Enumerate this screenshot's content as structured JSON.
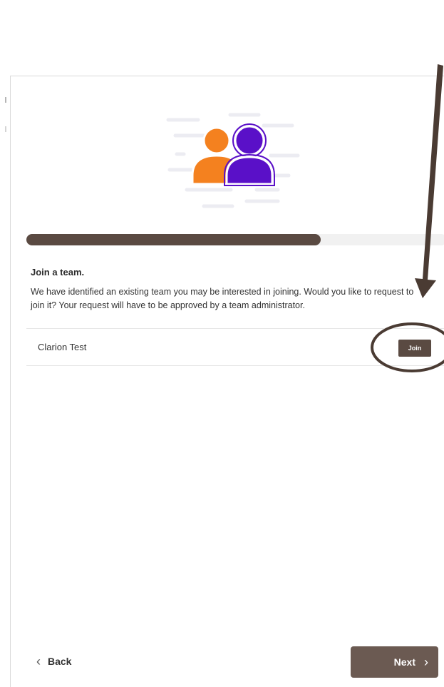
{
  "wizard": {
    "progress_fraction": 0.7
  },
  "join_team": {
    "heading": "Join a team.",
    "description": "We have identified an existing team you may be interested in joining. Would you like to request to join it? Your request will have to be approved by a team administrator.",
    "teams": [
      {
        "name": "Clarion Test",
        "action_label": "Join"
      }
    ]
  },
  "footer": {
    "back_label": "Back",
    "next_label": "Next"
  },
  "icons": {
    "back": "chevron-left-icon",
    "next": "chevron-right-icon",
    "illustration": "people-icon"
  },
  "colors": {
    "accent_brown": "#5a4a42",
    "person_orange": "#f4811f",
    "person_purple": "#5a10c8",
    "annotation_dark": "#4a3b33"
  }
}
